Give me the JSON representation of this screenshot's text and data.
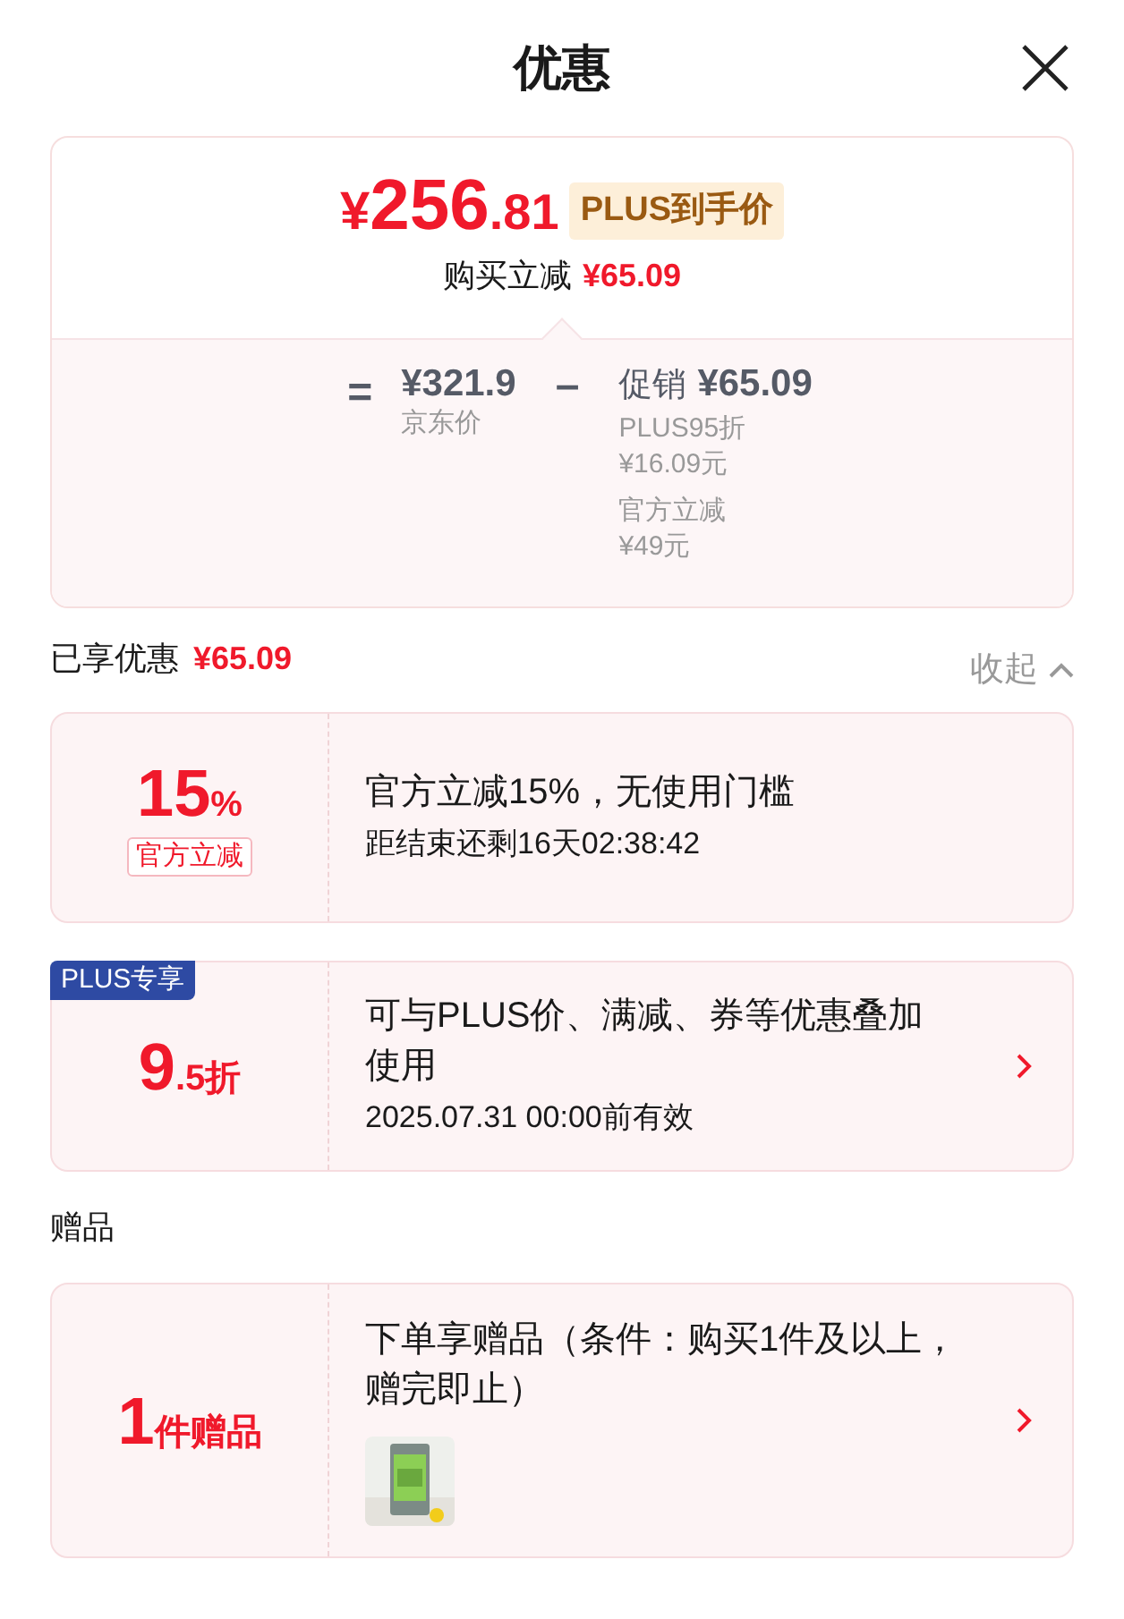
{
  "header": {
    "title": "优惠"
  },
  "price": {
    "currency": "¥",
    "integer": "256",
    "decimal": ".81",
    "tag": "PLUS到手价",
    "saving_label": "购买立减",
    "saving_value": "¥65.09"
  },
  "breakdown": {
    "equals": "=",
    "base_price": "¥321.9",
    "base_label": "京东价",
    "minus": "–",
    "promo_label": "促销",
    "promo_value": "¥65.09",
    "items": [
      {
        "name": "PLUS95折",
        "amount": "¥16.09元"
      },
      {
        "name": "官方立减",
        "amount": "¥49元"
      }
    ]
  },
  "enjoyed": {
    "label": "已享优惠",
    "value": "¥65.09",
    "toggle": "收起",
    "expanded": true
  },
  "offers": [
    {
      "kind": "discount",
      "big": "15",
      "small": "%",
      "tag": "官方立减",
      "title": "官方立减15%，无使用门槛",
      "subtitle": "距结束还剩16天02:38:42",
      "has_arrow": false
    },
    {
      "kind": "plus",
      "badge": "PLUS专享",
      "big": "9",
      "small": ".5折",
      "title": "可与PLUS价、满减、券等优惠叠加使用",
      "subtitle": "2025.07.31 00:00前有效",
      "has_arrow": true
    }
  ],
  "gifts_heading": "赠品",
  "gifts": [
    {
      "kind": "gift",
      "big": "1",
      "small": "件赠品",
      "title": "下单享赠品（条件：购买1件及以上，赠完即止）",
      "has_arrow": true
    }
  ]
}
